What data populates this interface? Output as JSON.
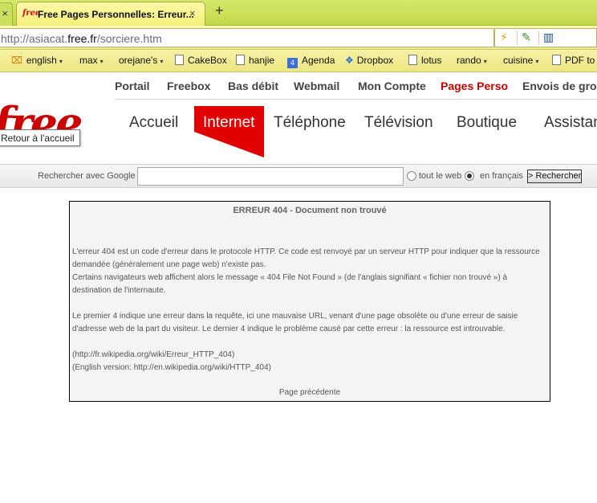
{
  "browser": {
    "prev_tab_close": "×",
    "active_tab": {
      "favicon_text": "free",
      "title": "Free Pages Personnelles: Erreur...",
      "close": "×"
    },
    "new_tab": "+",
    "url": {
      "prefix": "http://asiacat.",
      "domain": "free.fr",
      "path": "/sorciere.htm"
    },
    "nav_icons": [
      "lightning-icon",
      "pin-icon",
      "book-icon"
    ],
    "bookmarks": [
      {
        "label": "english",
        "icon": "rss-icon",
        "menu": true
      },
      {
        "label": "max",
        "icon": "",
        "menu": true
      },
      {
        "label": "orejane's",
        "icon": "",
        "menu": true
      },
      {
        "label": "CakeBox",
        "icon": "page-icon",
        "menu": false
      },
      {
        "label": "hanjie",
        "icon": "page-icon",
        "menu": false
      },
      {
        "label": "Agenda",
        "icon": "calendar-icon",
        "menu": false
      },
      {
        "label": "Dropbox",
        "icon": "dropbox-icon",
        "menu": false
      },
      {
        "label": "lotus",
        "icon": "page-icon",
        "menu": false
      },
      {
        "label": "rando",
        "icon": "",
        "menu": true
      },
      {
        "label": "cuisine",
        "icon": "",
        "menu": true
      },
      {
        "label": "PDF to",
        "icon": "page-icon",
        "menu": false
      }
    ]
  },
  "site": {
    "top_links": [
      "Portail",
      "Freebox",
      "Bas débit",
      "Webmail",
      "Mon Compte",
      "Pages Perso",
      "Envois de gros"
    ],
    "active_top_link": "Pages Perso",
    "logo_text": "free",
    "tooltip": "Retour à l'accueil",
    "main_nav": [
      "Accueil",
      "Internet",
      "Téléphone",
      "Télévision",
      "Boutique",
      "Assistance"
    ],
    "active_nav": "Internet",
    "brand_color": "#cc0000",
    "search": {
      "label": "Rechercher avec Google",
      "value": "",
      "option_web": "tout le web",
      "option_fr": "en français",
      "selected": "en français",
      "button": "> Rechercher"
    }
  },
  "error": {
    "title": "ERREUR 404 - Document non trouvé",
    "para1": "L'erreur 404 est un code d'erreur dans le protocole HTTP. Ce code est renvoyé par un serveur HTTP pour indiquer que la ressource demandée (généralement une page web) n'existe pas.",
    "para2": "Certains navigateurs web affichent alors le message « 404 File Not Found » (de l'anglais signifiant « fichier non trouvé ») à destination de l'internaute.",
    "para3": "Le premier 4 indique une erreur dans la requête, ici une mauvaise URL, venant d'une page obsolète ou d'une erreur de saisie d'adresse web de la part du visiteur. Le dernier 4 indique le problème causé par cette erreur : la ressource est introuvable.",
    "link_fr": "(http://fr.wikipedia.org/wiki/Erreur_HTTP_404)",
    "link_en": "(English version: http://en.wikipedia.org/wiki/HTTP_404)",
    "back": "Page précédente"
  }
}
